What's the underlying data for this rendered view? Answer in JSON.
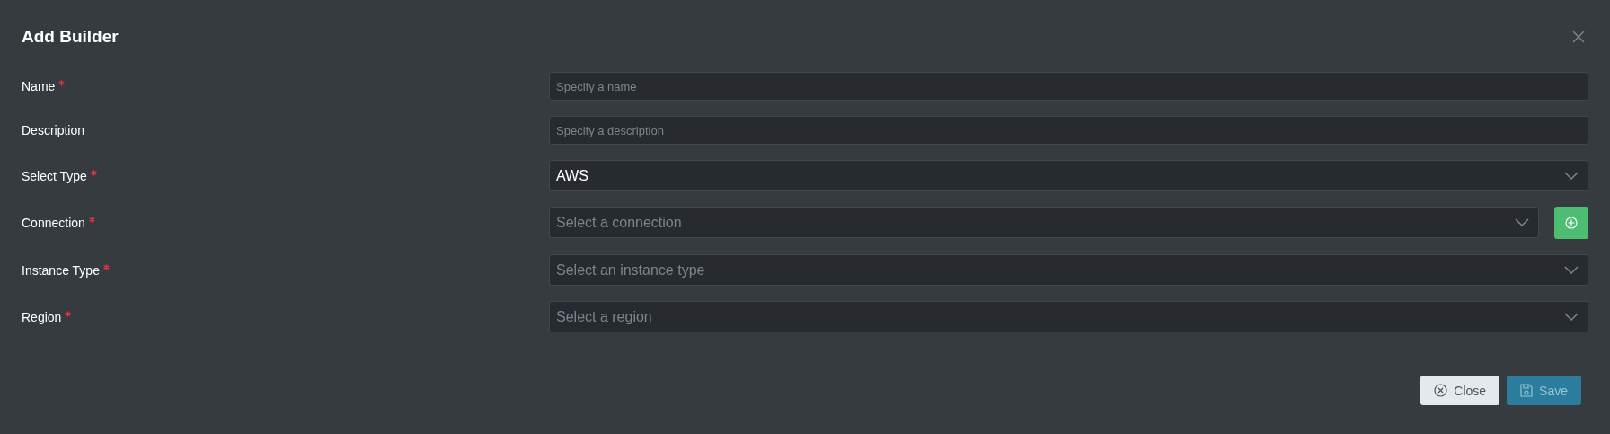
{
  "dialog": {
    "title": "Add Builder"
  },
  "fields": [
    {
      "label": "Name",
      "required": true,
      "kind": "input",
      "placeholder": "Specify a name"
    },
    {
      "label": "Description",
      "required": false,
      "kind": "input",
      "placeholder": "Specify a description"
    },
    {
      "label": "Select Type",
      "required": true,
      "kind": "select",
      "value": "AWS"
    },
    {
      "label": "Connection",
      "required": true,
      "kind": "select",
      "placeholder": "Select a connection",
      "add_button": true
    },
    {
      "label": "Instance Type",
      "required": true,
      "kind": "select",
      "placeholder": "Select an instance type"
    },
    {
      "label": "Region",
      "required": true,
      "kind": "select",
      "placeholder": "Select a region"
    }
  ],
  "buttons": [
    {
      "label": "Close",
      "kind": "secondary"
    },
    {
      "label": "Save",
      "kind": "primary"
    }
  ]
}
